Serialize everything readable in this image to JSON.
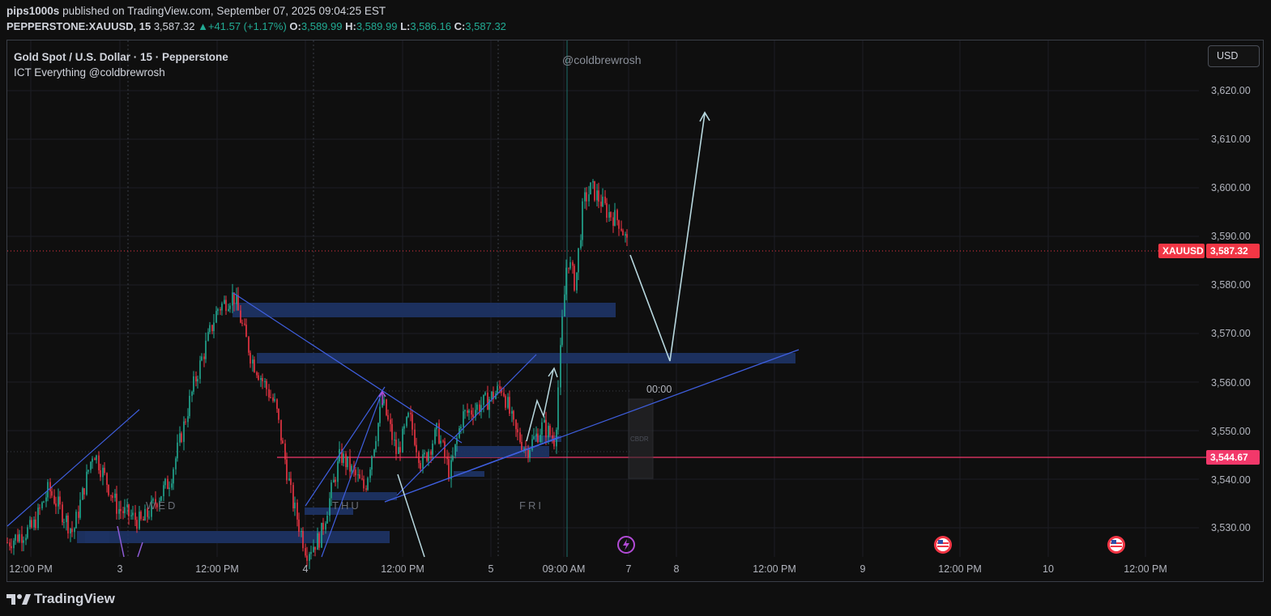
{
  "header": {
    "publisher": "pips1000s",
    "published_text": "published on TradingView.com, September 07, 2025 09:04:25 EST",
    "symbol": "PEPPERSTONE:XAUUSD, 15",
    "last": "3,587.32",
    "change": "+41.57 (+1.17%)",
    "o_label": "O:",
    "o": "3,589.99",
    "h_label": "H:",
    "h": "3,589.99",
    "l_label": "L:",
    "l": "3,586.16",
    "c_label": "C:",
    "c": "3,587.32"
  },
  "legend": {
    "title": "Gold Spot / U.S. Dollar · 15 · Pepperstone",
    "indicator": "ICT Everything @coldbrewrosh"
  },
  "watermark": "@coldbrewrosh",
  "currency_button": "USD",
  "price_axis": [
    "3,620.00",
    "3,610.00",
    "3,600.00",
    "3,590.00",
    "3,580.00",
    "3,570.00",
    "3,560.00",
    "3,550.00",
    "3,540.00",
    "3,530.00"
  ],
  "time_axis": [
    "12:00 PM",
    "3",
    "12:00 PM",
    "4",
    "12:00 PM",
    "5",
    "09:00 AM",
    "7",
    "8",
    "12:00 PM",
    "9",
    "12:00 PM",
    "10",
    "12:00 PM"
  ],
  "day_labels": [
    "WED",
    "THU",
    "FRI"
  ],
  "price_tags": {
    "symbol_tag": "XAUUSD",
    "current_price": "3,587.32",
    "level_price": "3,544.67"
  },
  "session_clock": "00:00",
  "box_label": "CBDR",
  "footer_logo": "TradingView",
  "colors": {
    "background": "#0f0f0f",
    "up": "#22ab94",
    "down": "#f23645",
    "trendline": "#3f5fe0",
    "zone": "#1e3363",
    "level_line": "#f2386a",
    "projection": "#b8d8df",
    "price_tag": "#f23645"
  },
  "icons": [
    "lightning-event-icon",
    "us-flag-event-icon",
    "us-flag-event-icon",
    "tradingview-logo-icon"
  ]
}
